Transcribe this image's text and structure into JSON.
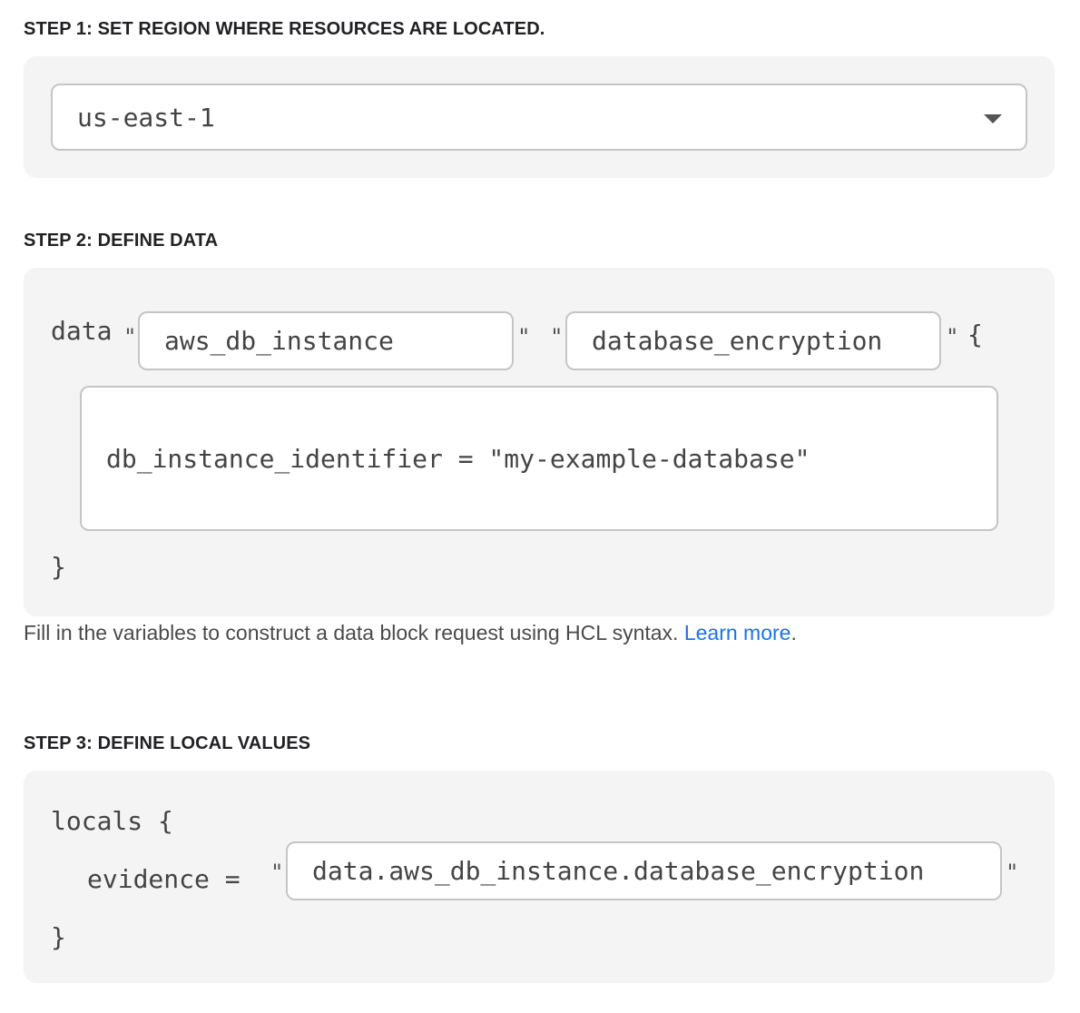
{
  "step1": {
    "title": "STEP 1: SET REGION WHERE RESOURCES ARE LOCATED.",
    "region_select": {
      "selected": "us-east-1",
      "icon": "chevron-down-icon"
    }
  },
  "step2": {
    "title": "STEP 2: DEFINE DATA",
    "keyword_data": "data",
    "open_quote": "\"",
    "close_quote": "\"",
    "resource_type_value": "aws_db_instance",
    "resource_name_value": "database_encryption",
    "open_brace": "{",
    "close_brace": "}",
    "body_value": "db_instance_identifier = \"my-example-database\"",
    "helper_text": "Fill in the variables to construct a data block request using HCL syntax.",
    "learn_more_label": "Learn more",
    "helper_period": "."
  },
  "step3": {
    "title": "STEP 3: DEFINE LOCAL VALUES",
    "keyword_locals": "locals {",
    "evidence_label": "evidence =",
    "open_quote": "\"",
    "close_quote": "\"",
    "evidence_value": "data.aws_db_instance.database_encryption",
    "close_brace": "}"
  },
  "colors": {
    "panel_bg": "#f4f4f5",
    "field_border": "#c5c5c5",
    "link": "#1a73e8",
    "text": "#202124"
  }
}
